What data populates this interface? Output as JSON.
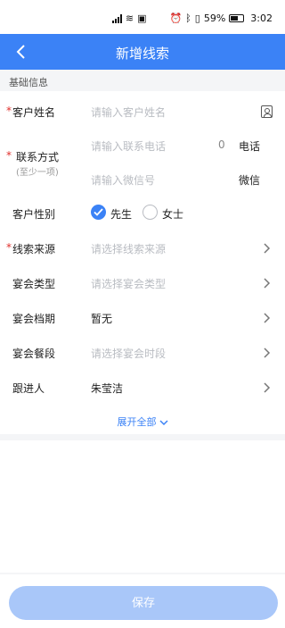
{
  "status_bar": {
    "battery": "59%",
    "time": "3:02"
  },
  "header": {
    "title": "新增线索"
  },
  "section": {
    "label": "基础信息"
  },
  "form": {
    "required_mark": "*",
    "customer_name": {
      "label": "客户姓名",
      "placeholder": "请输入客户姓名"
    },
    "contact": {
      "label": "联系方式",
      "hint": "(至少一项)",
      "phone_placeholder": "请输入联系电话",
      "phone_count": "0",
      "phone_type": "电话",
      "wechat_placeholder": "请输入微信号",
      "wechat_type": "微信"
    },
    "gender": {
      "label": "客户性别",
      "options": [
        "先生",
        "女士"
      ],
      "selected": "先生"
    },
    "source": {
      "label": "线索来源",
      "placeholder": "请选择线索来源"
    },
    "banquet_type": {
      "label": "宴会类型",
      "placeholder": "请选择宴会类型"
    },
    "schedule": {
      "label": "宴会档期",
      "value": "暂无"
    },
    "meal_period": {
      "label": "宴会餐段",
      "placeholder": "请选择宴会时段"
    },
    "follower": {
      "label": "跟进人",
      "value": "朱莹洁"
    },
    "expand_label": "展开全部"
  },
  "footer": {
    "save_label": "保存"
  },
  "colors": {
    "primary": "#3b82f6",
    "save_disabled": "#a9c7f9",
    "required": "#e0302c"
  }
}
